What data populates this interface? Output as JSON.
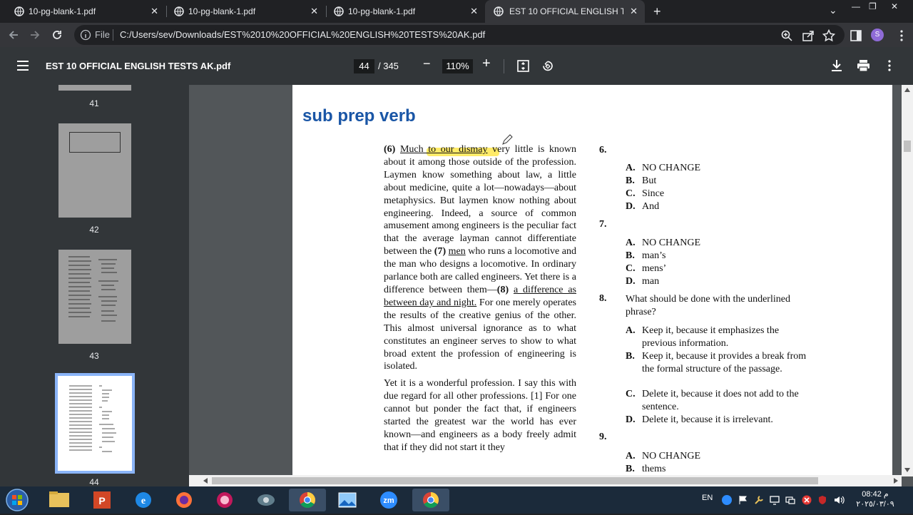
{
  "tabs": [
    {
      "title": "10-pg-blank-1.pdf",
      "close": "✕"
    },
    {
      "title": "10-pg-blank-1.pdf",
      "close": "✕"
    },
    {
      "title": "10-pg-blank-1.pdf",
      "close": "✕"
    },
    {
      "title": "EST 10 OFFICIAL ENGLISH TESTS",
      "close": "✕"
    }
  ],
  "new_tab": "+",
  "window": {
    "minimize": "—",
    "restore": "❐",
    "close": "✕",
    "tab_search": "⌄"
  },
  "address": {
    "scheme_label": "File",
    "url": "C:/Users/sev/Downloads/EST%2010%20OFFICIAL%20ENGLISH%20TESTS%20AK.pdf"
  },
  "profile_initial": "S",
  "pdf": {
    "title": "EST 10 OFFICIAL ENGLISH TESTS AK.pdf",
    "current_page": "44",
    "total_pages": "/ 345",
    "zoom": "110%",
    "zoom_minus": "−",
    "zoom_plus": "+"
  },
  "thumbnails": [
    {
      "label": "41"
    },
    {
      "label": "42"
    },
    {
      "label": "43"
    },
    {
      "label": "44"
    }
  ],
  "page": {
    "heading": "sub prep verb",
    "passage_p1_num": "(6)",
    "passage_p1_u": "Much to our dismay",
    "passage_p1_a": " very little is known about it among those outside of the profession. Laymen know something about law, a little about medicine, quite a lot—nowadays—about metaphysics. But laymen know nothing about engineering. Indeed, a source of common amusement among engineers is the peculiar fact that the average layman cannot differentiate between the ",
    "passage_p1_num7": "(7)",
    "passage_p1_u7": "men",
    "passage_p1_b": " who runs a locomotive and the man who designs a locomotive. In ordinary parlance both are called engineers. Yet there is a difference between them—",
    "passage_p1_num8": "(8)",
    "passage_p1_u8": "a difference as between day and night.",
    "passage_p1_c": " For one merely operates the results of the creative genius of the other. This almost universal ignorance as to what constitutes an engineer serves to show to what broad extent the profession of engineering is isolated.",
    "passage_p2": "Yet it is a wonderful profession. I say this with due regard for all other professions. [1] For one cannot but ponder the fact that, if engineers started the greatest war the world has ever known—and engineers as a body freely admit that if they did not start it they"
  },
  "questions": [
    {
      "num": "6.",
      "text": "",
      "options": [
        {
          "letter": "A.",
          "text": "NO CHANGE"
        },
        {
          "letter": "B.",
          "text": "But"
        },
        {
          "letter": "C.",
          "text": "Since"
        },
        {
          "letter": "D.",
          "text": "And"
        }
      ]
    },
    {
      "num": "7.",
      "text": "",
      "options": [
        {
          "letter": "A.",
          "text": "NO CHANGE"
        },
        {
          "letter": "B.",
          "text": "man’s"
        },
        {
          "letter": "C.",
          "text": "mens’"
        },
        {
          "letter": "D.",
          "text": "man"
        }
      ]
    },
    {
      "num": "8.",
      "text": "What should be done with the underlined phrase?",
      "options": [
        {
          "letter": "A.",
          "text": "Keep it, because it emphasizes the previous information."
        },
        {
          "letter": "B.",
          "text": "Keep it, because it provides a break from the formal structure of the passage."
        },
        {
          "letter": "C.",
          "text": "Delete it, because it does not add to the sentence."
        },
        {
          "letter": "D.",
          "text": "Delete it, because it is irrelevant."
        }
      ]
    },
    {
      "num": "9.",
      "text": "",
      "options": [
        {
          "letter": "A.",
          "text": "NO CHANGE"
        },
        {
          "letter": "B.",
          "text": "thems"
        }
      ]
    }
  ],
  "taskbar": {
    "lang": "EN",
    "clock_time": "08:42 م",
    "clock_date": "٢٠٢٥/٠٣/٠٩"
  },
  "colors": {
    "heading": "#1a56a6",
    "highlight": "#ffe84d",
    "thumb_selected": "#8ab4f8"
  }
}
